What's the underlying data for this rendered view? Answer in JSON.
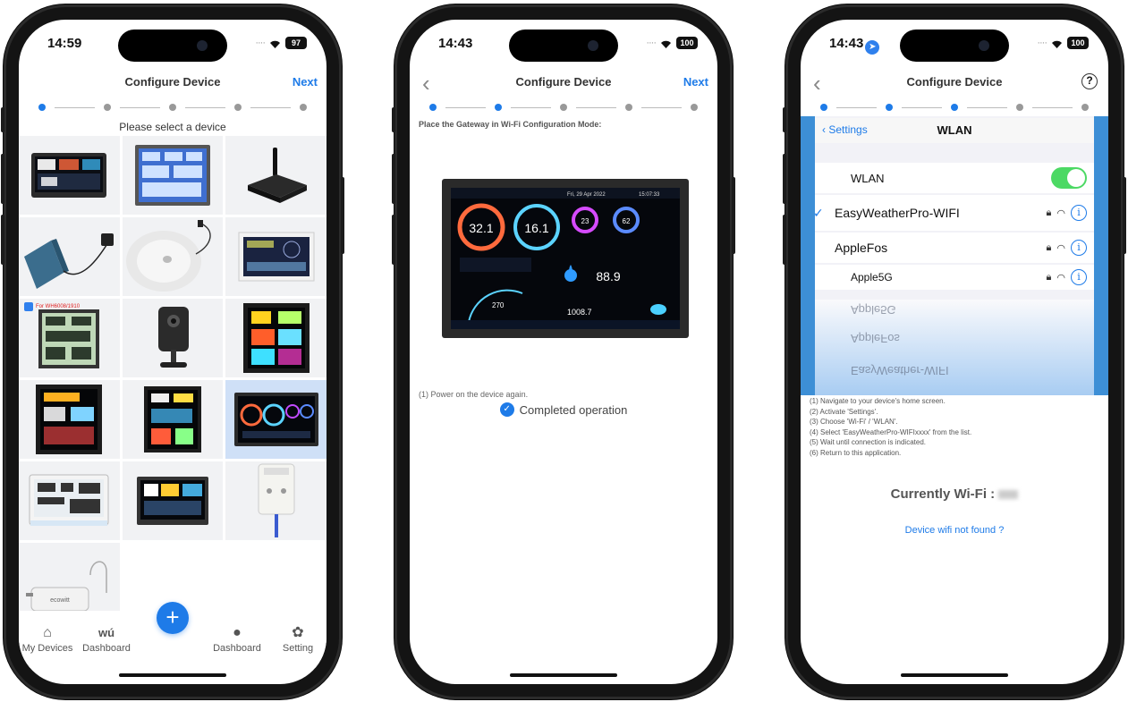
{
  "phone1": {
    "time": "14:59",
    "battery": "97",
    "title": "Configure Device",
    "next_label": "Next",
    "steps": 5,
    "active_step": 1,
    "select_label": "Please select a device",
    "tag_text": "For WH6008/1910",
    "fab_label": "+",
    "tabs": [
      {
        "label": "My Devices",
        "icon": "home-icon"
      },
      {
        "label": "Dashboard",
        "icon": "wu-logo",
        "glyph": "wú"
      },
      {
        "label": "Dashboard",
        "icon": "weather-icon"
      },
      {
        "label": "Setting",
        "icon": "gear-icon"
      }
    ]
  },
  "phone2": {
    "time": "14:43",
    "battery": "100",
    "title": "Configure Device",
    "next_label": "Next",
    "active_step": 2,
    "instruction": "Place the Gateway in Wi-Fi Configuration Mode:",
    "display": {
      "date": "Fri, 29 Apr 2022",
      "clock": "15:07:33",
      "outdoor_temp": "32.1",
      "indoor_temp": "16.1",
      "humidity_a": "23",
      "humidity_b": "62",
      "rain": "88.9",
      "pressure": "1008.7",
      "wind": "270"
    },
    "power_line": "(1) Power on the device again.",
    "completed_label": "Completed operation"
  },
  "phone3": {
    "time": "14:43",
    "battery": "100",
    "title": "Configure Device",
    "active_step": 3,
    "settings_back": "Settings",
    "wlan_title": "WLAN",
    "wlan_toggle_label": "WLAN",
    "networks": [
      {
        "name": "EasyWeatherPro-WIFI",
        "connected": true
      },
      {
        "name": "AppleFos",
        "connected": false
      },
      {
        "name": "Apple5G",
        "connected": false
      }
    ],
    "reflection": [
      "Apple5G",
      "AppleFos",
      "EasyWeather-WIFI"
    ],
    "steps_list": [
      "(1) Navigate to your device's home screen.",
      "(2) Activate 'Settings'.",
      "(3) Choose 'Wi-Fi' / 'WLAN'.",
      "(4) Select 'EasyWeatherPro-WIFIxxxx' from the list.",
      "(5) Wait until connection is indicated.",
      "(6) Return to this application."
    ],
    "currently_label": "Currently Wi-Fi :",
    "not_found_label": "Device wifi not found ?"
  },
  "colors": {
    "accent": "#1e7be8",
    "toggle_on": "#4cd964",
    "selected_cell": "#cfe0f7"
  }
}
